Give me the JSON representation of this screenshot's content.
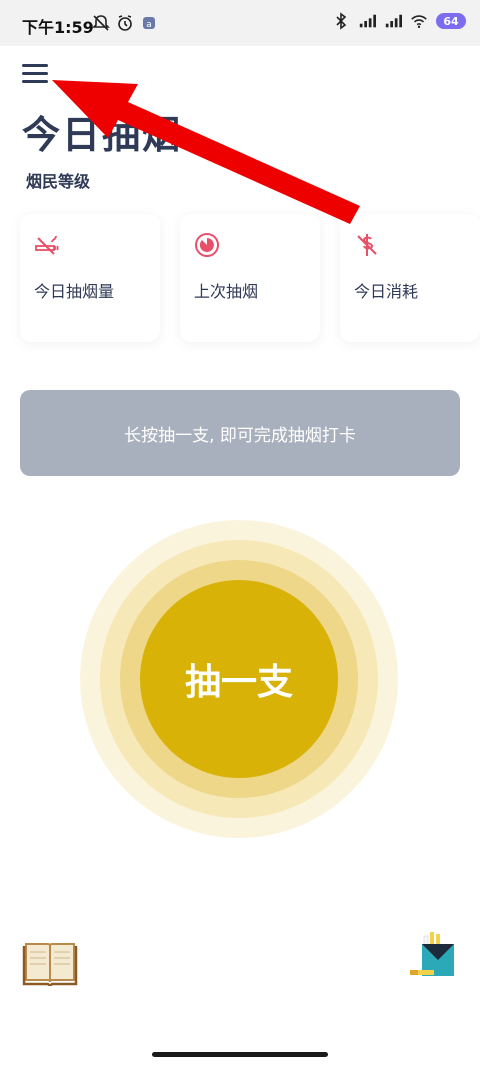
{
  "status_bar": {
    "time": "下午1:59",
    "battery": "64",
    "icons": [
      "silent-bell-icon",
      "alarm-icon",
      "app-notif-icon",
      "bluetooth-icon",
      "signal-icon",
      "signal-icon",
      "wifi-icon",
      "battery-icon"
    ]
  },
  "header": {
    "menu_icon": "hamburger-menu-icon",
    "title": "今日抽烟",
    "rank_label": "烟民等级"
  },
  "cards": [
    {
      "label": "今日抽烟量",
      "icon": "no-smoking-icon"
    },
    {
      "label": "上次抽烟",
      "icon": "clock-pie-icon"
    },
    {
      "label": "今日消耗",
      "icon": "no-money-icon"
    }
  ],
  "hint": "长按抽一支, 即可完成抽烟打卡",
  "main_button": {
    "label": "抽一支"
  },
  "bottom": {
    "left_icon": "book-icon",
    "right_icon": "cigarette-pack-icon"
  },
  "colors": {
    "accent_gold": "#d9b208",
    "card_icon_red": "#e8506a",
    "arrow_red": "#ee0000",
    "hint_bg": "#a9b0bd"
  }
}
